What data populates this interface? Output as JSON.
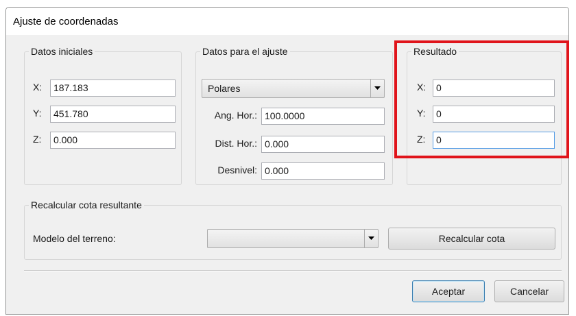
{
  "window": {
    "title": "Ajuste de coordenadas"
  },
  "datos_iniciales": {
    "legend": "Datos iniciales",
    "x_label": "X:",
    "x_value": "187.183",
    "y_label": "Y:",
    "y_value": "451.780",
    "z_label": "Z:",
    "z_value": "0.000"
  },
  "datos_ajuste": {
    "legend": "Datos para el ajuste",
    "method_selected": "Polares",
    "ang_label": "Ang. Hor.:",
    "ang_value": "100.0000",
    "dist_label": "Dist. Hor.:",
    "dist_value": "0.000",
    "desnivel_label": "Desnivel:",
    "desnivel_value": "0.000"
  },
  "resultado": {
    "legend": "Resultado",
    "x_label": "X:",
    "x_value": "0",
    "y_label": "Y:",
    "y_value": "0",
    "z_label": "Z:",
    "z_value": "0"
  },
  "recalcular": {
    "legend": "Recalcular cota resultante",
    "modelo_label": "Modelo del terreno:",
    "modelo_selected": "",
    "button_label": "Recalcular cota"
  },
  "footer": {
    "ok_label": "Aceptar",
    "cancel_label": "Cancelar"
  },
  "colors": {
    "highlight": "#e0141b",
    "focus_border": "#569de5"
  }
}
